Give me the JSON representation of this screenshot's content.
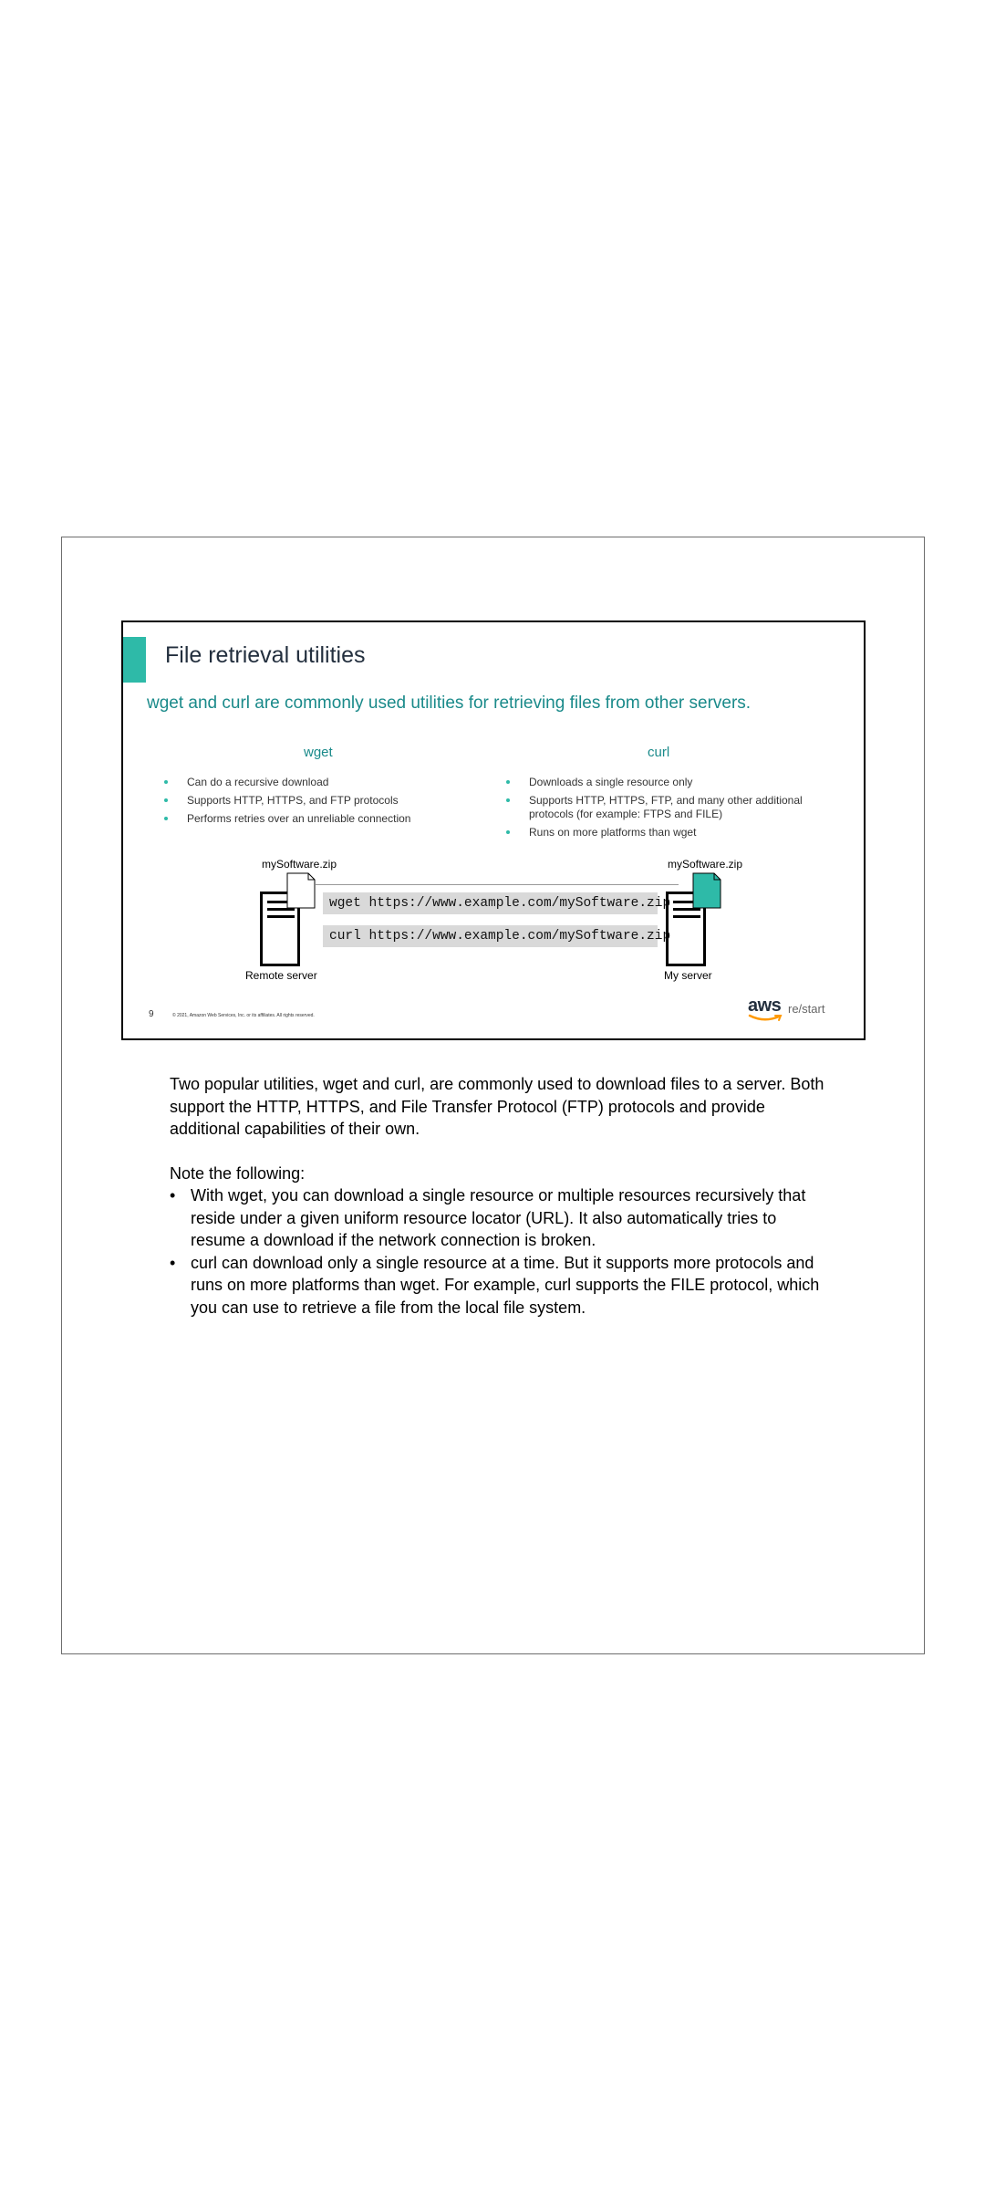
{
  "slide": {
    "title": "File retrieval utilities",
    "subtitle": "wget and curl are commonly used utilities for retrieving files from other servers.",
    "wget": {
      "heading": "wget",
      "bullets": [
        "Can do a recursive download",
        "Supports HTTP, HTTPS, and FTP protocols",
        "Performs retries over an unreliable connection"
      ]
    },
    "curl": {
      "heading": "curl",
      "bullets": [
        "Downloads a single resource only",
        "Supports HTTP, HTTPS, FTP, and many other additional protocols (for example: FTPS and FILE)",
        "Runs on more platforms than wget"
      ]
    },
    "diagram": {
      "left_file": "mySoftware.zip",
      "right_file": "mySoftware.zip",
      "left_server": "Remote server",
      "right_server": "My server",
      "cmd_wget": "wget https://www.example.com/mySoftware.zip",
      "cmd_curl": "curl https://www.example.com/mySoftware.zip"
    },
    "page_number": "9",
    "copyright": "© 2021, Amazon Web Services, Inc. or its affiliates. All rights reserved.",
    "logo_text": "aws",
    "logo_suffix": "re/start",
    "colors": {
      "accent": "#2ebaa8",
      "teal_text": "#1a8a8a",
      "logo_smile": "#ff9900"
    }
  },
  "notes": {
    "intro": "Two popular utilities, wget and curl, are commonly used to download files to a server. Both support the HTTP, HTTPS, and File Transfer Protocol (FTP) protocols and provide additional capabilities of their own.",
    "note_heading": "Note the following:",
    "bullets": [
      "With wget, you can download a single resource or multiple resources recursively that reside under a given uniform resource locator (URL). It also automatically tries to resume a download if the network connection is broken.",
      "curl can download only a single resource at a time. But it supports more protocols and runs on more platforms than wget. For example, curl supports the FILE protocol, which you can use to retrieve a file from the local file system."
    ]
  }
}
